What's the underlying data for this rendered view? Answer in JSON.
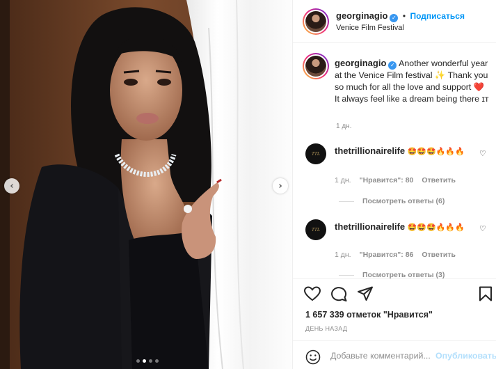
{
  "post": {
    "username": "georginagio",
    "follow_label": "Подписаться",
    "location": "Venice Film Festival",
    "caption": "Another wonderful year at the Venice Film festival ✨ Thank you so much for all the love and support ❤️ It always feel like a dream being there ɪᴛ",
    "caption_time": "1 дн."
  },
  "comments": [
    {
      "username": "thetrillionairelife",
      "text": "🤩🤩🤩🔥🔥🔥",
      "time": "1 дн.",
      "likes": "\"Нравится\": 80",
      "reply_label": "Ответить",
      "view_replies": "Посмотреть ответы (6)"
    },
    {
      "username": "thetrillionairelife",
      "text": "🤩🤩🤩🔥🔥🔥",
      "time": "1 дн.",
      "likes": "\"Нравится\": 86",
      "reply_label": "Ответить",
      "view_replies": "Посмотреть ответы (3)"
    }
  ],
  "stats": {
    "likes_text": "1 657 339 отметок \"Нравится\"",
    "posted_ago": "ДЕНЬ НАЗАД"
  },
  "composer": {
    "placeholder": "Добавьте комментарий...",
    "post_label": "Опубликовать"
  },
  "carousel": {
    "total": 4,
    "active": 2
  },
  "icons": {
    "prev": "chevron-left-icon",
    "next": "chevron-right-icon",
    "like": "heart-icon",
    "comment": "comment-icon",
    "share": "share-icon",
    "save": "bookmark-icon",
    "emoji": "smiley-icon"
  },
  "colors": {
    "link": "#0095f6",
    "verified": "#3897f0",
    "muted": "#8e8e8e",
    "post_disabled": "#b2dffc"
  }
}
